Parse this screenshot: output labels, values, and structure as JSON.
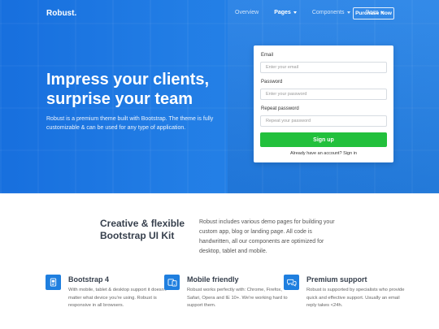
{
  "nav": {
    "brand": "Robust.",
    "links": [
      {
        "label": "Overview",
        "has_caret": false
      },
      {
        "label": "Pages",
        "has_caret": true
      },
      {
        "label": "Components",
        "has_caret": true
      },
      {
        "label": "Docs",
        "has_caret": true
      }
    ],
    "active": "Pages",
    "purchase_label": "Purchase Now"
  },
  "hero": {
    "title_line1": "Impress your clients,",
    "title_line2": "surprise your team",
    "description": "Robust is a premium theme built with Bootstrap. The theme is fully customizable & can be used for any type of application."
  },
  "signup_form": {
    "email_label": "Email",
    "email_placeholder": "Enter your email",
    "password_label": "Password",
    "password_placeholder": "Enter your password",
    "repeat_label": "Repeat password",
    "repeat_placeholder": "Repeat your password",
    "submit_label": "Sign up",
    "signin_prompt": "Already have an account?",
    "signin_link": "Sign in"
  },
  "intro": {
    "heading_line1": "Creative & flexible",
    "heading_line2": "Bootstrap UI Kit",
    "text": "Robust includes various demo pages for building your custom app, blog or landing page. All code is handwritten, all our components are optimized for desktop, tablet and mobile."
  },
  "features": [
    {
      "icon": "bootstrap-icon",
      "title": "Bootstrap 4",
      "text": "With mobile, tablet & desktop support it doesn't matter what device you're using. Robust is responsive in all browsers."
    },
    {
      "icon": "mobile-devices-icon",
      "title": "Mobile friendly",
      "text": "Robust works perfectly with: Chrome, Firefox, Safari, Opera and IE 10+. We're working hard to support them."
    },
    {
      "icon": "chat-bubbles-icon",
      "title": "Premium support",
      "text": "Robust is supported by specialists who provide quick and effective support. Usually an email reply takes <24h."
    }
  ],
  "colors": {
    "hero_blue": "#1e77dd",
    "signup_green": "#22c03c",
    "icon_blue": "#1f7fdf"
  }
}
